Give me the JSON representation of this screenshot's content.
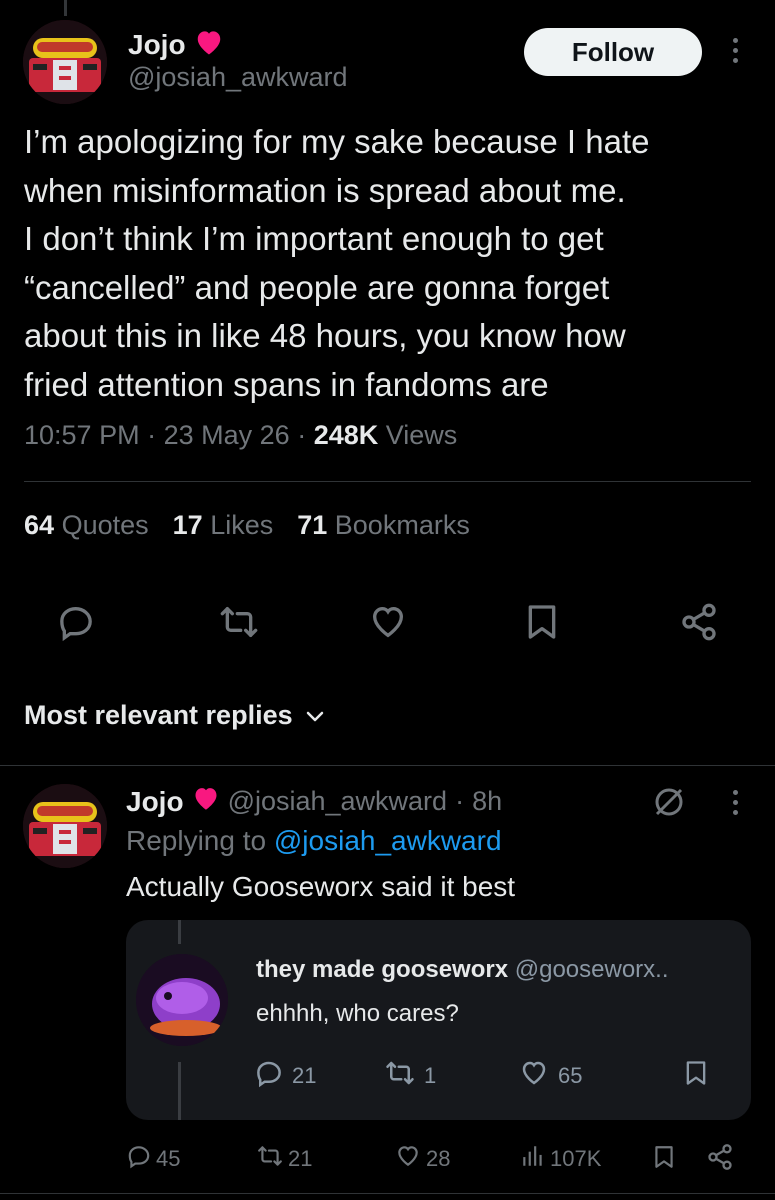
{
  "main_post": {
    "author_name": "Jojo",
    "author_handle": "@josiah_awkward",
    "follow_label": "Follow",
    "text": "I’m apologizing for my sake because I hate\nwhen misinformation is spread about me.\nI don’t think I’m important enough to get\n“cancelled” and people are gonna forget\nabout this in like 48 hours, you know how\nfried attention spans in fandoms are",
    "time": "10:57 PM",
    "date": "23 May 26",
    "views_count": "248K",
    "views_label": "Views",
    "quotes_count": "64",
    "quotes_label": "Quotes",
    "likes_count": "17",
    "likes_label": "Likes",
    "bookmarks_count": "71",
    "bookmarks_label": "Bookmarks"
  },
  "replies_sort": {
    "label": "Most relevant replies"
  },
  "reply": {
    "author_name": "Jojo",
    "author_handle": "@josiah_awkward",
    "age": "8h",
    "replying_prefix": "Replying to",
    "replying_to": "@josiah_awkward",
    "text": "Actually Gooseworx said it best",
    "embedded": {
      "name": "they made gooseworx",
      "handle": "@gooseworx..",
      "text": "ehhhh, who cares?",
      "replies": "21",
      "reposts": "1",
      "likes": "65"
    },
    "replies_count": "45",
    "reposts_count": "21",
    "likes_count": "28",
    "views_count": "107K"
  },
  "colors": {
    "background": "#000000",
    "text": "#e7e9ea",
    "muted": "#71767b",
    "link": "#1d9bf0",
    "heart": "#f91880"
  },
  "icons": [
    "heart-emoji-icon",
    "more-icon",
    "reply-icon",
    "repost-icon",
    "like-icon",
    "bookmark-icon",
    "share-icon",
    "chevron-down-icon",
    "grok-icon",
    "views-icon"
  ]
}
